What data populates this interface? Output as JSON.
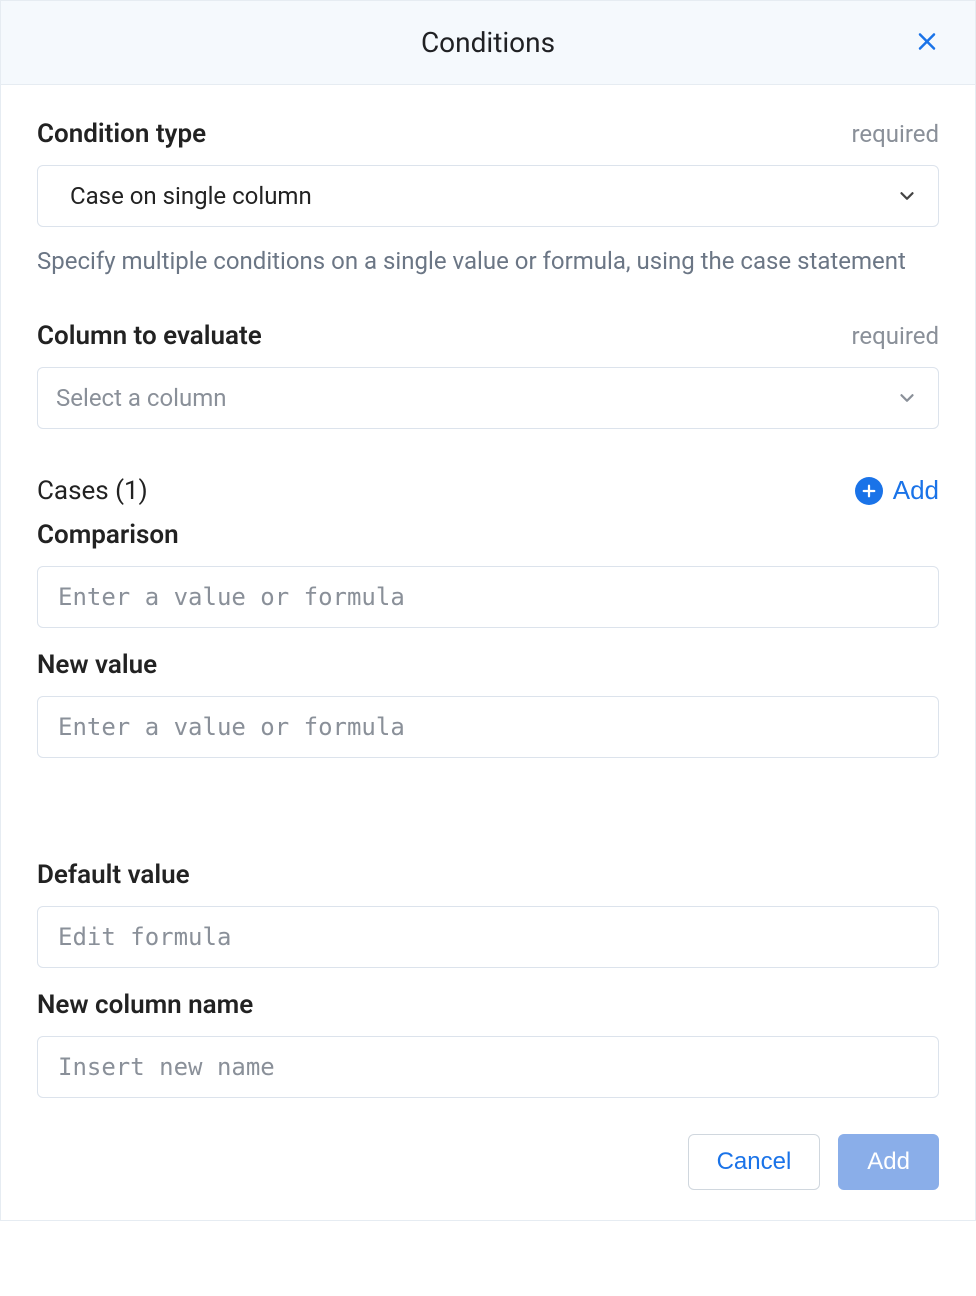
{
  "header": {
    "title": "Conditions"
  },
  "required_label": "required",
  "condition_type": {
    "label": "Condition type",
    "value": "Case on single column",
    "help": "Specify multiple conditions on a single value or formula, using the case statement"
  },
  "column_to_evaluate": {
    "label": "Column to evaluate",
    "placeholder": "Select a column"
  },
  "cases": {
    "heading": "Cases (1)",
    "add_label": "Add"
  },
  "comparison": {
    "label": "Comparison",
    "placeholder": "Enter a value or formula"
  },
  "new_value": {
    "label": "New value",
    "placeholder": "Enter a value or formula"
  },
  "default_value": {
    "label": "Default value",
    "placeholder": "Edit formula"
  },
  "new_column_name": {
    "label": "New column name",
    "placeholder": "Insert new name"
  },
  "footer": {
    "cancel": "Cancel",
    "add": "Add"
  }
}
